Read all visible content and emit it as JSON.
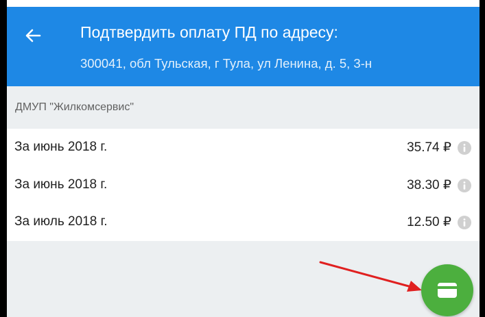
{
  "header": {
    "title": "Подтвердить оплату ПД по адресу:",
    "address": "300041, обл Тульская, г Тула, ул Ленина, д. 5, 3-н",
    "back_icon": "arrow-left-icon",
    "background_color": "#1e88e5"
  },
  "provider": {
    "name": "ДМУП \"Жилкомсервис\""
  },
  "payments": [
    {
      "period": "За июнь 2018 г.",
      "amount": "35.74 ₽",
      "info_icon": "info-icon"
    },
    {
      "period": "За июнь 2018 г.",
      "amount": "38.30 ₽",
      "info_icon": "info-icon"
    },
    {
      "period": "За июль 2018 г.",
      "amount": "12.50 ₽",
      "info_icon": "info-icon"
    }
  ],
  "fab": {
    "icon": "credit-card-icon",
    "color": "#4caf3e"
  },
  "annotation": {
    "icon": "red-arrow-icon",
    "color": "#e02020"
  }
}
